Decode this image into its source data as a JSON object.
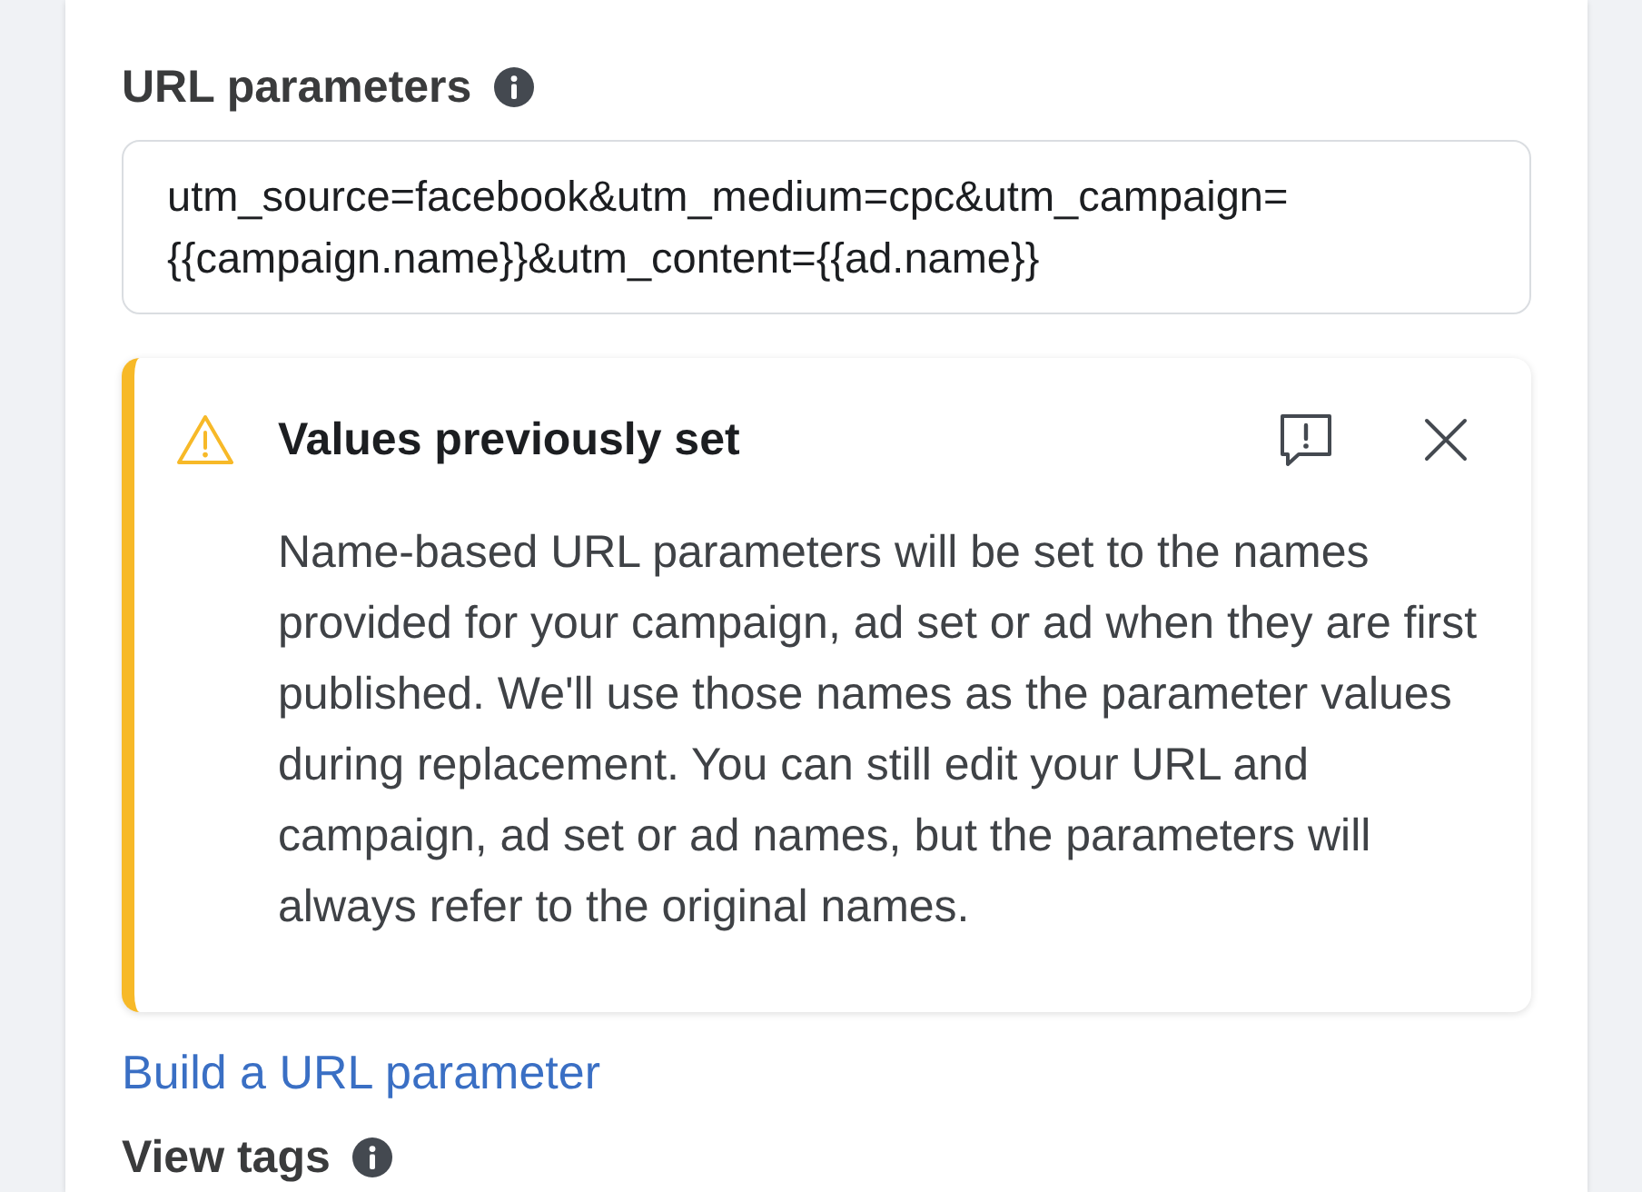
{
  "url_parameters": {
    "label": "URL parameters",
    "value": "utm_source=facebook&utm_medium=cpc&utm_campaign={{campaign.name}}&utm_content={{ad.name}}"
  },
  "notice": {
    "kind": "warning",
    "title": "Values previously set",
    "body": "Name-based URL parameters will be set to the names provided for your campaign, ad set or ad when they are first published. We'll use those names as the parameter values during replacement. You can still edit your URL and campaign, ad set or ad names, but the parameters will always refer to the original names."
  },
  "build_link": {
    "label": "Build a URL parameter"
  },
  "view_tags": {
    "label": "View tags"
  }
}
